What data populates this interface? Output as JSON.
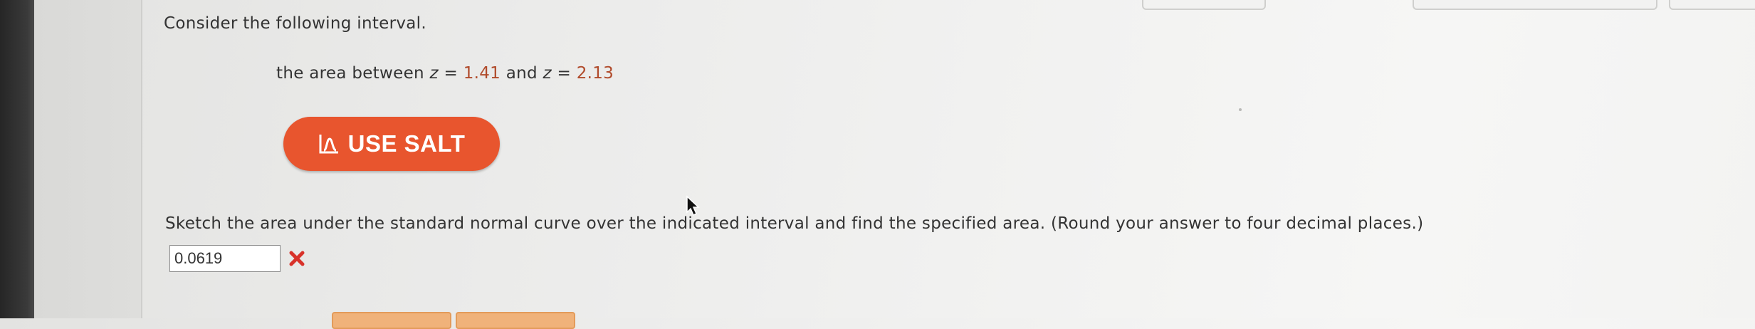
{
  "question": {
    "prompt": "Consider the following interval.",
    "interval": {
      "prefix": "the area between ",
      "var1": "z",
      "eq1": " = ",
      "value1": "1.41",
      "and": " and ",
      "var2": "z",
      "eq2": " = ",
      "value2": "2.13"
    },
    "salt_button_label": "USE SALT",
    "instruction": "Sketch the area under the standard normal curve over the indicated interval and find the specified area. (Round your answer to four decimal places.)",
    "answer_value": "0.0619",
    "answer_status": "incorrect"
  },
  "colors": {
    "salt_button": "#e8552e",
    "number_highlight": "#b04a2a",
    "incorrect_mark": "#d8322a"
  },
  "icons": {
    "salt": "normal-curve-icon",
    "status": "x-mark-icon"
  }
}
